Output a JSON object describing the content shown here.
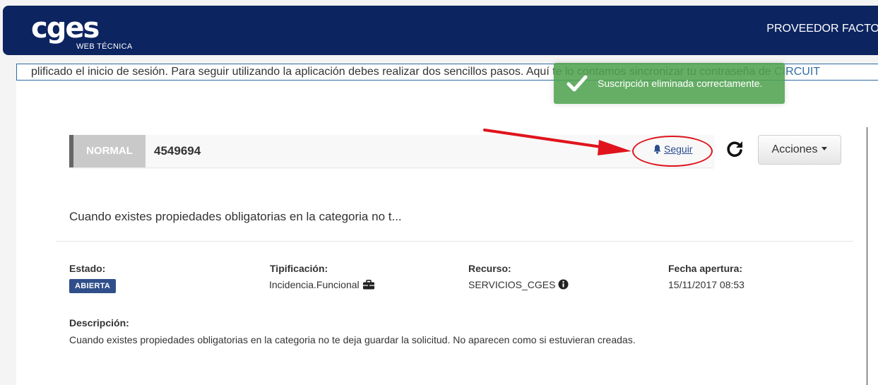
{
  "header": {
    "logo_text": "cges",
    "logo_subtitle": "WEB TÉCNICA",
    "provider_label": "PROVEEDOR FACTORI"
  },
  "notice": {
    "text": "plificado el inicio de sesión. Para seguir utilizando la aplicación debes realizar dos sencillos pasos. Aquí te lo contamos sincronizar tu contraseña de ",
    "link_text": "CIRCUIT"
  },
  "toast": {
    "message": "Suscripción eliminada correctamente."
  },
  "ticket": {
    "priority": "NORMAL",
    "id": "4549694",
    "follow_label": "Seguir",
    "actions_label": "Acciones",
    "summary": "Cuando existes propiedades obligatorias en la categoria no t..."
  },
  "details": {
    "estado_label": "Estado:",
    "estado_value": "ABIERTA",
    "tipificacion_label": "Tipificación:",
    "tipificacion_value": "Incidencia.Funcional",
    "recurso_label": "Recurso:",
    "recurso_value": "SERVICIOS_CGES",
    "fecha_label": "Fecha apertura:",
    "fecha_value": "15/11/2017 08:53",
    "descripcion_label": "Descripción:",
    "descripcion_value": "Cuando existes propiedades obligatorias en la categoria no te deja guardar la solicitud. No aparecen como si estuvieran creadas."
  },
  "colors": {
    "navbar": "#0c2460",
    "toast": "#51a351",
    "badge": "#2f4e8a",
    "annotation": "#e0141c"
  },
  "icons": [
    "check-icon",
    "bell-icon",
    "refresh-icon",
    "caret-down-icon",
    "briefcase-icon",
    "info-icon",
    "arrow-annotation"
  ]
}
